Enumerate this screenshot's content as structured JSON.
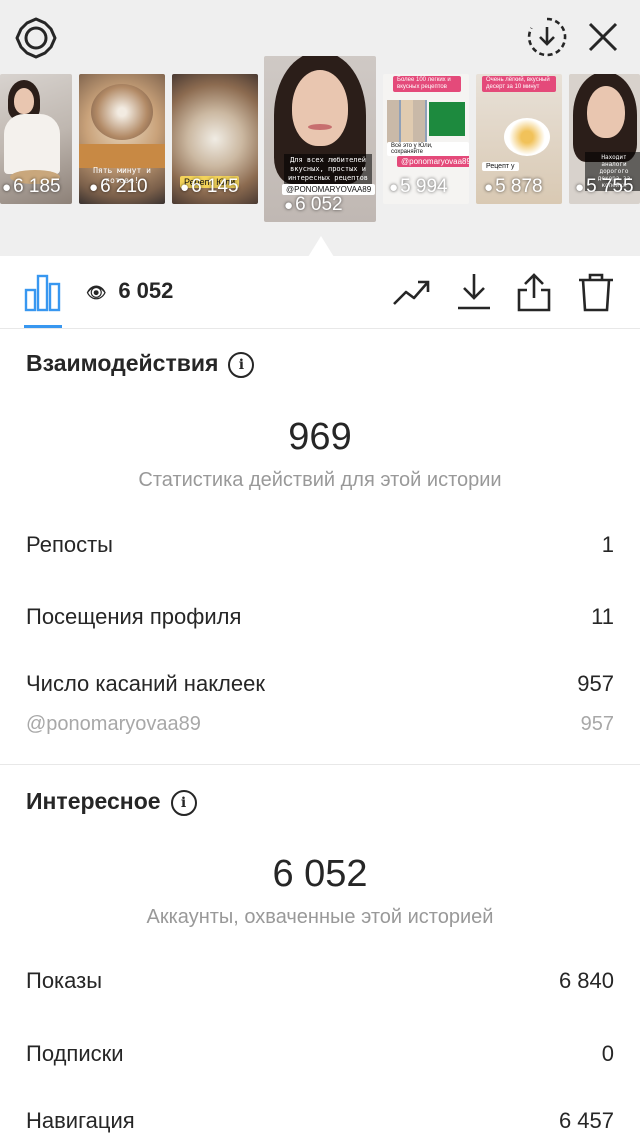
{
  "header": {
    "icons": [
      "gear-icon",
      "download-circle-icon",
      "close-icon"
    ]
  },
  "stories": [
    {
      "views": "6 185"
    },
    {
      "views": "6 210",
      "caption": "Пять минут и готово!"
    },
    {
      "views": "6 145",
      "caption": "Рецепт Юли"
    },
    {
      "views": "6 052",
      "caption": "Для всех любителей вкусных, простых и интересных рецептов",
      "mention": "@PONOMARYOVAA89",
      "active": true
    },
    {
      "views": "5 994",
      "caption": "Более 100 легких и вкусных рецептов",
      "mention": "@ponomaryovaa89",
      "extra": "Всё это у Юли, сохраняйте"
    },
    {
      "views": "5 878",
      "caption": "Очень лёгкий, вкусный десерт за 10 минут",
      "extra": "Рецепт у"
    },
    {
      "views": "5 755",
      "caption": "Находит аналоги дорогого декора за копейки"
    }
  ],
  "toolbar": {
    "views": "6 052",
    "icons": [
      "bar-chart-icon",
      "eye-icon",
      "trend-up-icon",
      "download-icon",
      "share-icon",
      "trash-icon"
    ]
  },
  "interactions": {
    "title": "Взаимодействия",
    "total": "969",
    "subtitle": "Статистика действий для этой истории",
    "rows": [
      {
        "label": "Репосты",
        "value": "1"
      },
      {
        "label": "Посещения профиля",
        "value": "11"
      },
      {
        "label": "Число касаний наклеек",
        "value": "957"
      },
      {
        "label": "@ponomaryovaa89",
        "value": "957"
      }
    ]
  },
  "discovery": {
    "title": "Интересное",
    "total": "6 052",
    "subtitle": "Аккаунты, охваченные этой историей",
    "rows": [
      {
        "label": "Показы",
        "value": "6 840"
      },
      {
        "label": "Подписки",
        "value": "0"
      },
      {
        "label": "Навигация",
        "value": "6 457"
      }
    ]
  },
  "colors": {
    "accent": "#3897f0",
    "text": "#262626",
    "muted": "#999999",
    "top_bg": "#efefef"
  }
}
